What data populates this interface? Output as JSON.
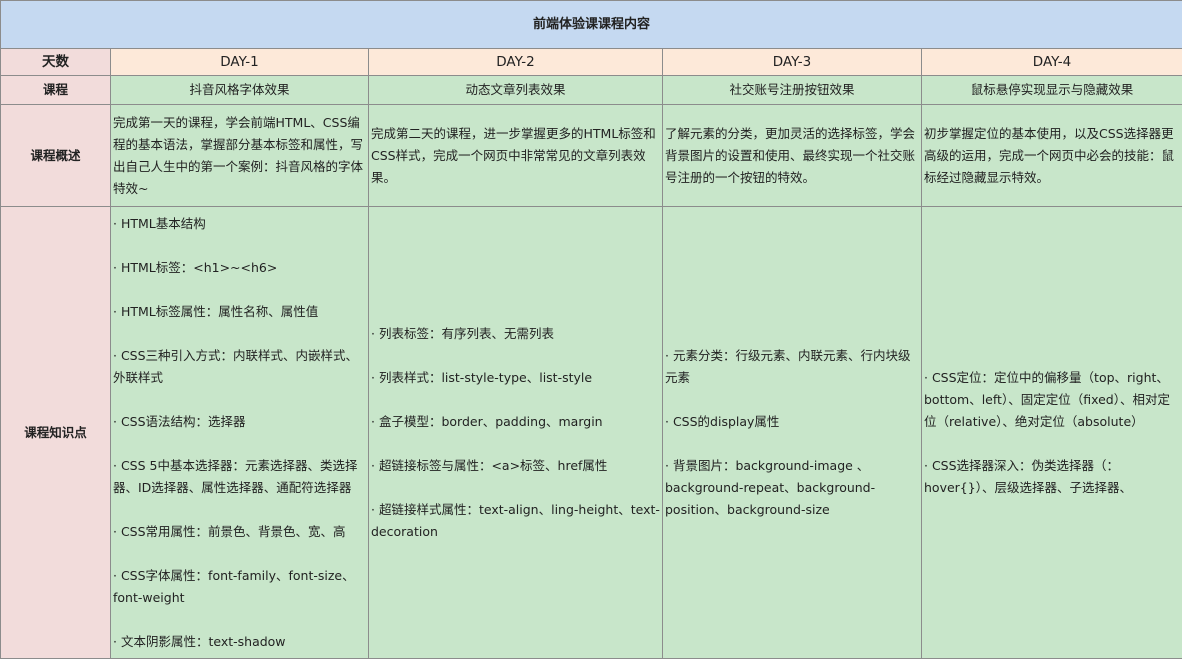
{
  "title": "前端体验课课程内容",
  "row_labels": {
    "day": "天数",
    "course": "课程",
    "overview": "课程概述",
    "knowledge": "课程知识点"
  },
  "days": [
    {
      "day": "DAY-1",
      "course": "抖音风格字体效果",
      "overview": "完成第一天的课程，学会前端HTML、CSS编程的基本语法，掌握部分基本标签和属性，写出自己人生中的第一个案例：抖音风格的字体特效~",
      "points": [
        "· HTML基本结构",
        "· HTML标签：<h1>~<h6>",
        "· HTML标签属性：属性名称、属性值",
        "· CSS三种引入方式：内联样式、内嵌样式、外联样式",
        "· CSS语法结构：选择器",
        "· CSS 5中基本选择器：元素选择器、类选择器、ID选择器、属性选择器、通配符选择器",
        "· CSS常用属性：前景色、背景色、宽、高",
        "· CSS字体属性：font-family、font-size、font-weight",
        "· 文本阴影属性：text-shadow"
      ]
    },
    {
      "day": "DAY-2",
      "course": "动态文章列表效果",
      "overview": "完成第二天的课程，进一步掌握更多的HTML标签和CSS样式，完成一个网页中非常常见的文章列表效果。",
      "points": [
        "· 列表标签：有序列表、无需列表",
        "· 列表样式：list-style-type、list-style",
        "· 盒子模型：border、padding、margin",
        "· 超链接标签与属性：<a>标签、href属性",
        "· 超链接样式属性：text-align、ling-height、text-decoration"
      ]
    },
    {
      "day": "DAY-3",
      "course": "社交账号注册按钮效果",
      "overview": "了解元素的分类，更加灵活的选择标签，学会背景图片的设置和使用、最终实现一个社交账号注册的一个按钮的特效。",
      "points": [
        "· 元素分类：行级元素、内联元素、行内块级元素",
        "· CSS的display属性",
        "· 背景图片：background-image 、background-repeat、background-position、background-size"
      ]
    },
    {
      "day": "DAY-4",
      "course": "鼠标悬停实现显示与隐藏效果",
      "overview": "初步掌握定位的基本使用，以及CSS选择器更高级的运用，完成一个网页中必会的技能：鼠标经过隐藏显示特效。",
      "points": [
        "· CSS定位：定位中的偏移量（top、right、bottom、left）、固定定位（fixed）、相对定位（relative）、绝对定位（absolute）",
        "· CSS选择器深入：伪类选择器（：hover{}）、层级选择器、子选择器、"
      ]
    }
  ]
}
